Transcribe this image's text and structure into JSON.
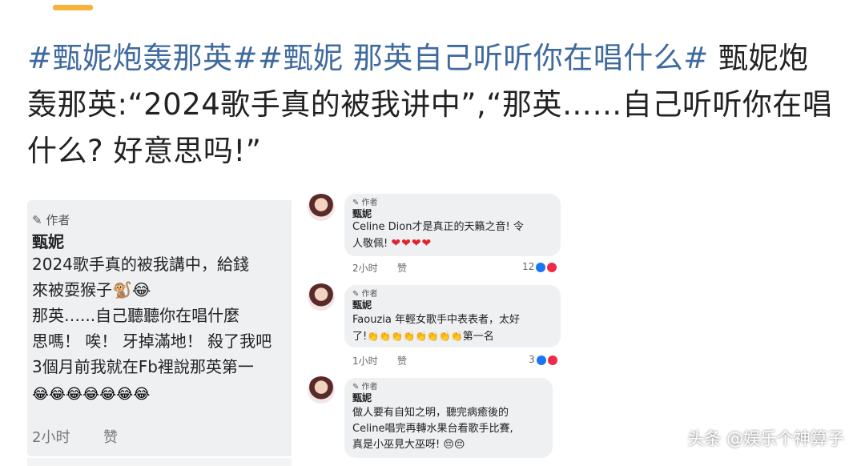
{
  "post": {
    "tag1": "#甄妮炮轰那英#",
    "tag2": "#甄妮 那英自己听听你在唱什么#",
    "text": " 甄妮炮轰那英:“2024歌手真的被我讲中”,“那英……自己听听你在唱什么? 好意思吗!”"
  },
  "left_comment": {
    "author_tag": "✎ 作者",
    "name": "甄妮",
    "lines": [
      "2024歌手真的被我講中，給錢",
      "來被耍猴子🐒😂",
      "那英…...自己聽聽你在唱什麼",
      "思嗎！ 唉！ 牙掉滿地！ 殺了我吧",
      "3個月前我就在Fb裡說那英第一"
    ],
    "emoji": "😂😂😂😂😂😂😂",
    "time": "2小时",
    "like": "赞"
  },
  "right_comments": [
    {
      "author_tag": "✎ 作者",
      "name": "甄妮",
      "line1": "Celine Dion才是真正的天籟之音! 令",
      "line2": "人敬佩!",
      "emoji": "❤❤❤❤",
      "time": "2小时",
      "like": "赞",
      "count": "12"
    },
    {
      "author_tag": "✎ 作者",
      "name": "甄妮",
      "line1": "Faouzia 年輕女歌手中表表者，太好",
      "line2": "了!",
      "emoji": "👏👏👏👏👏👏👏👏",
      "tail": "第一名",
      "time": "1小时",
      "like": "赞",
      "count": "3"
    },
    {
      "author_tag": "✎ 作者",
      "name": "甄妮",
      "line1": "做人要有自知之明，聽完病癒後的",
      "line2": "Celine唱完再轉水果台看歌手比賽,",
      "line3": "真是小巫見大巫呀!",
      "emoji": "😔😔"
    }
  ],
  "watermark": "头条 @娱乐个神算子",
  "colors": {
    "hashtag": "#3f6a9e",
    "accent_bar": "#f5b33a",
    "bubble": "#eef0f2"
  }
}
